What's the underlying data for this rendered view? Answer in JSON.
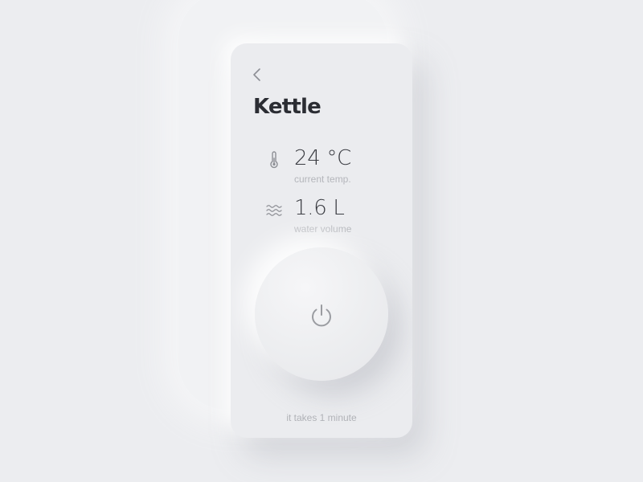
{
  "screen": {
    "title": "Kettle",
    "back_icon": "chevron-left-icon"
  },
  "stats": {
    "temperature": {
      "icon": "thermometer-icon",
      "value": "24 °C",
      "label": "current temp."
    },
    "volume": {
      "icon": "water-waves-icon",
      "value": "1.6 L",
      "label": "water volume"
    }
  },
  "power": {
    "icon": "power-icon"
  },
  "footer": {
    "note": "it takes 1 minute"
  }
}
